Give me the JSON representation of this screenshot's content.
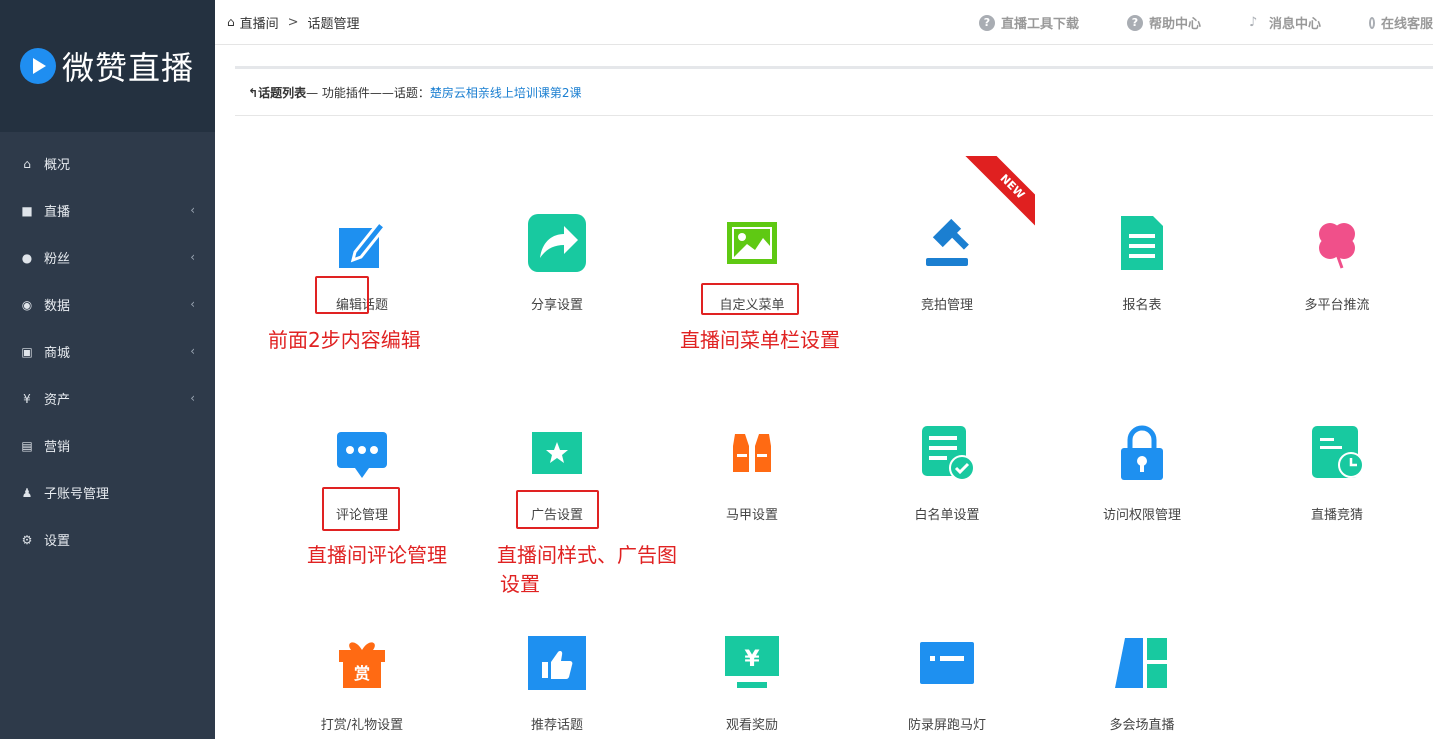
{
  "sidebar": {
    "logo_text": "微赞直播",
    "items": [
      {
        "label": "概况",
        "icon": "home-icon",
        "arrow": false
      },
      {
        "label": "直播",
        "icon": "video-icon",
        "arrow": true
      },
      {
        "label": "粉丝",
        "icon": "user-icon",
        "arrow": true
      },
      {
        "label": "数据",
        "icon": "eye-icon",
        "arrow": true
      },
      {
        "label": "商城",
        "icon": "shop-icon",
        "arrow": true
      },
      {
        "label": "资产",
        "icon": "yen-icon",
        "arrow": true
      },
      {
        "label": "营销",
        "icon": "ticket-icon",
        "arrow": false
      },
      {
        "label": "子账号管理",
        "icon": "subaccount-icon",
        "arrow": false
      },
      {
        "label": "设置",
        "icon": "gear-icon",
        "arrow": false
      }
    ]
  },
  "header": {
    "crumb_home": "直播间",
    "crumb_sep": ">",
    "crumb_current": "话题管理",
    "links": [
      "直播工具下载",
      "帮助中心",
      "消息中心",
      "在线客服"
    ]
  },
  "subcrumb": {
    "back": "话题列表",
    "middle": "— 功能插件——话题：",
    "topic": "楚房云相亲线上培训课第2课"
  },
  "ribbon": "NEW",
  "tiles": [
    {
      "label": "编辑话题",
      "icon": "edit-icon"
    },
    {
      "label": "分享设置",
      "icon": "share-icon"
    },
    {
      "label": "自定义菜单",
      "icon": "image-icon"
    },
    {
      "label": "竞拍管理",
      "icon": "gavel-icon"
    },
    {
      "label": "报名表",
      "icon": "form-icon"
    },
    {
      "label": "多平台推流",
      "icon": "clover-icon"
    },
    {
      "label": "评论管理",
      "icon": "comment-icon"
    },
    {
      "label": "广告设置",
      "icon": "star-icon"
    },
    {
      "label": "马甲设置",
      "icon": "vest-icon"
    },
    {
      "label": "白名单设置",
      "icon": "whitelist-icon"
    },
    {
      "label": "访问权限管理",
      "icon": "lock-icon"
    },
    {
      "label": "直播竞猜",
      "icon": "clock-doc-icon"
    },
    {
      "label": "打赏/礼物设置",
      "icon": "gift-icon"
    },
    {
      "label": "推荐话题",
      "icon": "thumbsup-icon"
    },
    {
      "label": "观看奖励",
      "icon": "reward-icon"
    },
    {
      "label": "防录屏跑马灯",
      "icon": "marquee-icon"
    },
    {
      "label": "多会场直播",
      "icon": "multivenue-icon"
    }
  ],
  "annotations": {
    "note1": "前面2步内容编辑",
    "note2": "直播间菜单栏设置",
    "note3": "直播间评论管理",
    "note4_line1": "直播间样式、广告图",
    "note4_line2": "设置"
  },
  "colors": {
    "sidebar_bg": "#2e3a4a",
    "accent_blue": "#1b7fd1",
    "annotation_red": "#e02222"
  }
}
